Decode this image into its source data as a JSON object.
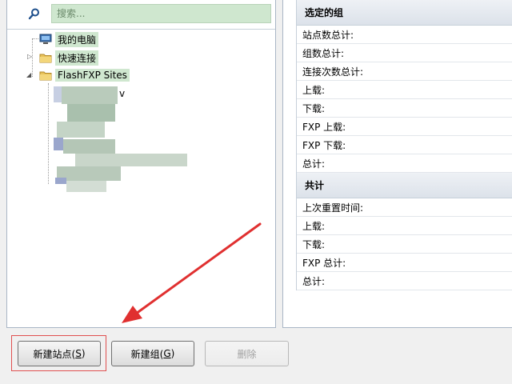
{
  "search": {
    "placeholder": "搜索..."
  },
  "tree": {
    "items": [
      {
        "label": "我的电脑",
        "icon": "computer-icon"
      },
      {
        "label": "快速连接",
        "icon": "folder-icon"
      },
      {
        "label": "FlashFXP Sites",
        "icon": "folder-icon",
        "expanded": true
      }
    ],
    "partial_child_text": "v"
  },
  "stats": {
    "selected_group_header": "选定的组",
    "selected_group_rows": [
      "站点数总计:",
      "组数总计:",
      "连接次数总计:",
      "上载:",
      "下载:",
      "FXP 上载:",
      "FXP 下载:",
      "总计:"
    ],
    "total_header": "共计",
    "total_rows": [
      "上次重置时间:",
      "上载:",
      "下载:",
      "FXP 总计:",
      "总计:"
    ]
  },
  "buttons": {
    "new_site": "新建站点(",
    "new_site_key": "S",
    "new_site_end": ")",
    "new_group": "新建组(",
    "new_group_key": "G",
    "new_group_end": ")",
    "delete": "删除"
  },
  "colors": {
    "selection_green": "#cfe7cf",
    "annotation_red": "#e03030"
  }
}
